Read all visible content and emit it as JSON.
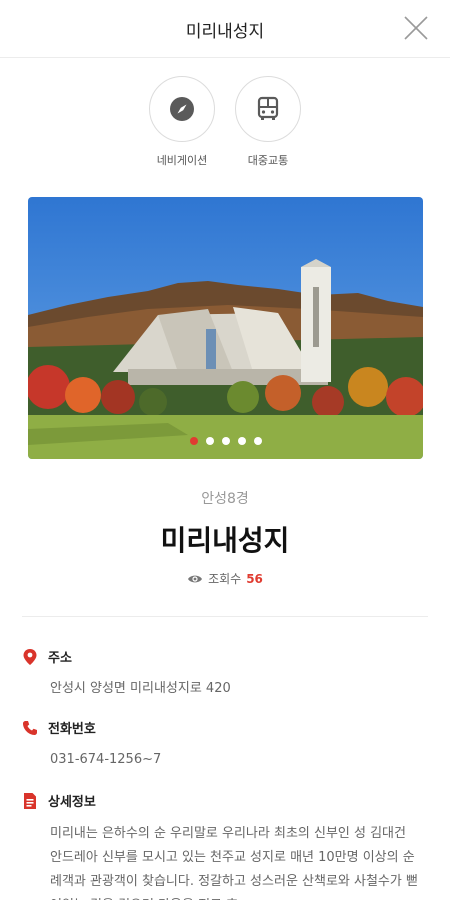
{
  "header": {
    "title": "미리내성지"
  },
  "actions": [
    {
      "label": "네비게이션",
      "icon": "compass-icon"
    },
    {
      "label": "대중교통",
      "icon": "bus-icon"
    }
  ],
  "carousel": {
    "total": 5,
    "active_index": 0
  },
  "place": {
    "category": "안성8경",
    "name": "미리내성지",
    "views_label": "조회수",
    "views_count": "56"
  },
  "info": {
    "address": {
      "label": "주소",
      "value": "안성시 양성면 미리내성지로 420"
    },
    "phone": {
      "label": "전화번호",
      "value": "031-674-1256~7"
    },
    "detail": {
      "label": "상세정보",
      "value": "미리내는 은하수의 순 우리말로 우리나라 최초의 신부인 성 김대건 안드레아 신부를 모시고 있는 천주교 성지로 매년 10만명 이상의 순례객과 관광객이 찾습니다. 정갈하고 성스러운 산책로와 사철수가 뻗어있는 길을 걸으며 마음을 정로 휴"
    }
  },
  "colors": {
    "accent": "#e03c31",
    "icon_dark": "#5a5a5a"
  }
}
